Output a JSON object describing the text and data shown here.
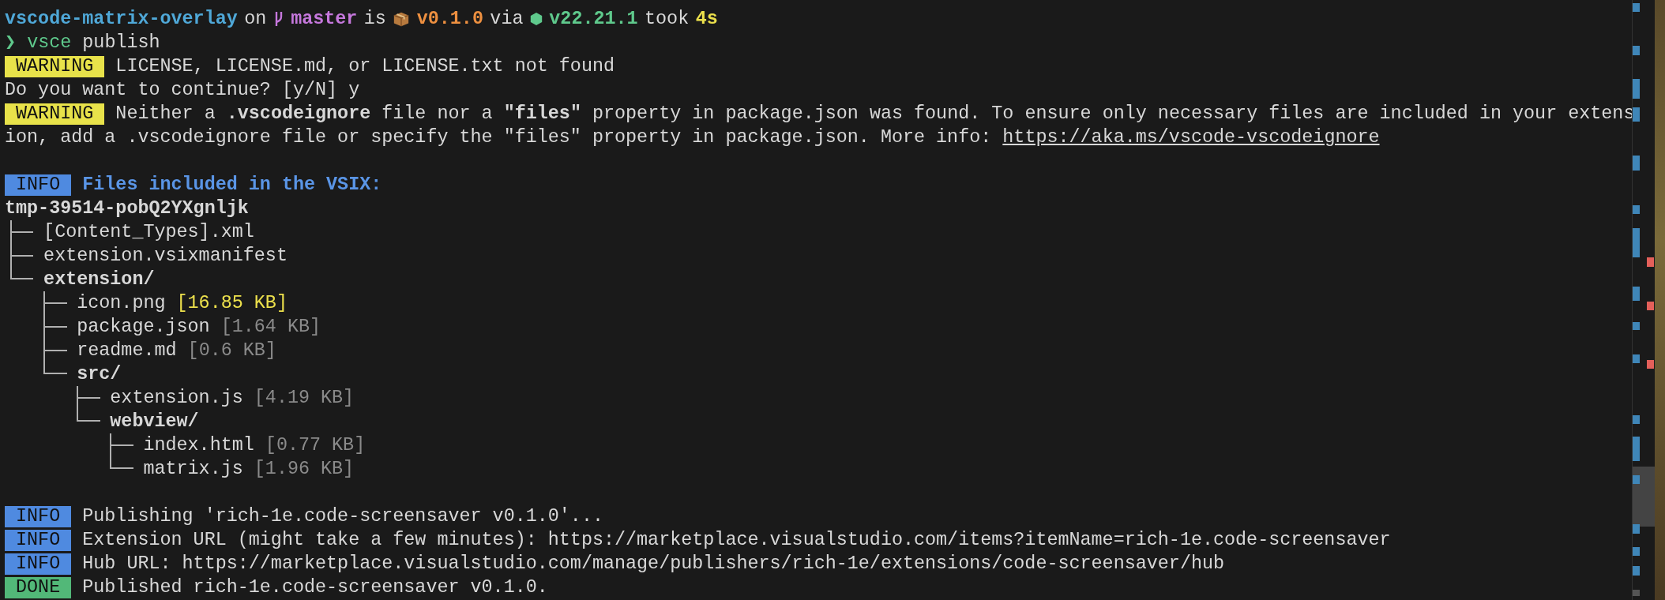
{
  "lines": [
    {
      "kind": "prompt",
      "segments": [
        {
          "kind": "directory",
          "text": "vscode-matrix-overlay"
        },
        {
          "kind": "plain",
          "text": "on"
        },
        {
          "kind": "branch",
          "text": "master"
        },
        {
          "kind": "plain",
          "text": "is"
        },
        {
          "kind": "version",
          "text": "v0.1.0"
        },
        {
          "kind": "plain",
          "text": "via"
        },
        {
          "kind": "node",
          "text": "v22.21.1"
        },
        {
          "kind": "plain",
          "text": "took"
        },
        {
          "kind": "duration",
          "text": "4s"
        }
      ]
    },
    {
      "kind": "command",
      "symbol": "❯",
      "program": "vsce",
      "args": "publish"
    },
    {
      "kind": "log",
      "color": "#e8e24a",
      "badge": "WARNING",
      "text": "LICENSE, LICENSE.md, or LICENSE.txt not found",
      "emphasis": false
    },
    {
      "kind": "text",
      "text": "Do you want to continue? [y/N] y"
    },
    {
      "kind": "log",
      "color": "#e8e24a",
      "badge": "WARNING",
      "text": "Neither a **.vscodeignore** file nor a **\"files\"** property in package.json was found. To ensure only necessary files are included in your extens",
      "emphasis": false
    },
    {
      "kind": "text",
      "text": "ion, add a .vscodeignore file or specify the \"files\" property in package.json. More info: ",
      "link": "https://aka.ms/vscode-vscodeignore"
    },
    {
      "kind": "blank"
    },
    {
      "kind": "log",
      "color": "#4f8ae0",
      "badge": "INFO",
      "text": "Files included in the VSIX:",
      "emphasis": true
    },
    {
      "kind": "tree",
      "root": "tmp-39514-pobQ2YXgnljk",
      "children": [
        {
          "name": "[Content_Types].xml",
          "folder": false
        },
        {
          "name": "extension.vsixmanifest",
          "folder": false
        },
        {
          "name": "extension/",
          "folder": true,
          "children": [
            {
              "name": "icon.png",
              "size": "[16.85 KB]",
              "highlight": true,
              "folder": false
            },
            {
              "name": "package.json",
              "size": "[1.64 KB]",
              "highlight": false,
              "folder": false
            },
            {
              "name": "readme.md",
              "size": "[0.6 KB]",
              "highlight": false,
              "folder": false
            },
            {
              "name": "src/",
              "folder": true,
              "children": [
                {
                  "name": "extension.js",
                  "size": "[4.19 KB]",
                  "highlight": false,
                  "folder": false
                },
                {
                  "name": "webview/",
                  "folder": true,
                  "children": [
                    {
                      "name": "index.html",
                      "size": "[0.77 KB]",
                      "highlight": false,
                      "folder": false
                    },
                    {
                      "name": "matrix.js",
                      "size": "[1.96 KB]",
                      "highlight": false,
                      "folder": false
                    }
                  ]
                }
              ]
            }
          ]
        }
      ]
    },
    {
      "kind": "blank"
    },
    {
      "kind": "log",
      "color": "#4f8ae0",
      "badge": "INFO",
      "text": "Publishing 'rich-1e.code-screensaver v0.1.0'...",
      "emphasis": false
    },
    {
      "kind": "log",
      "color": "#4f8ae0",
      "badge": "INFO",
      "text": "Extension URL (might take a few minutes): https://marketplace.visualstudio.com/items?itemName=rich-1e.code-screensaver",
      "emphasis": false
    },
    {
      "kind": "log",
      "color": "#4f8ae0",
      "badge": "INFO",
      "text": "Hub URL: https://marketplace.visualstudio.com/manage/publishers/rich-1e/extensions/code-screensaver/hub",
      "emphasis": false
    },
    {
      "kind": "log",
      "color": "#52b878",
      "badge": "DONE",
      "text": "Published rich-1e.code-screensaver v0.1.0.",
      "emphasis": false
    }
  ]
}
